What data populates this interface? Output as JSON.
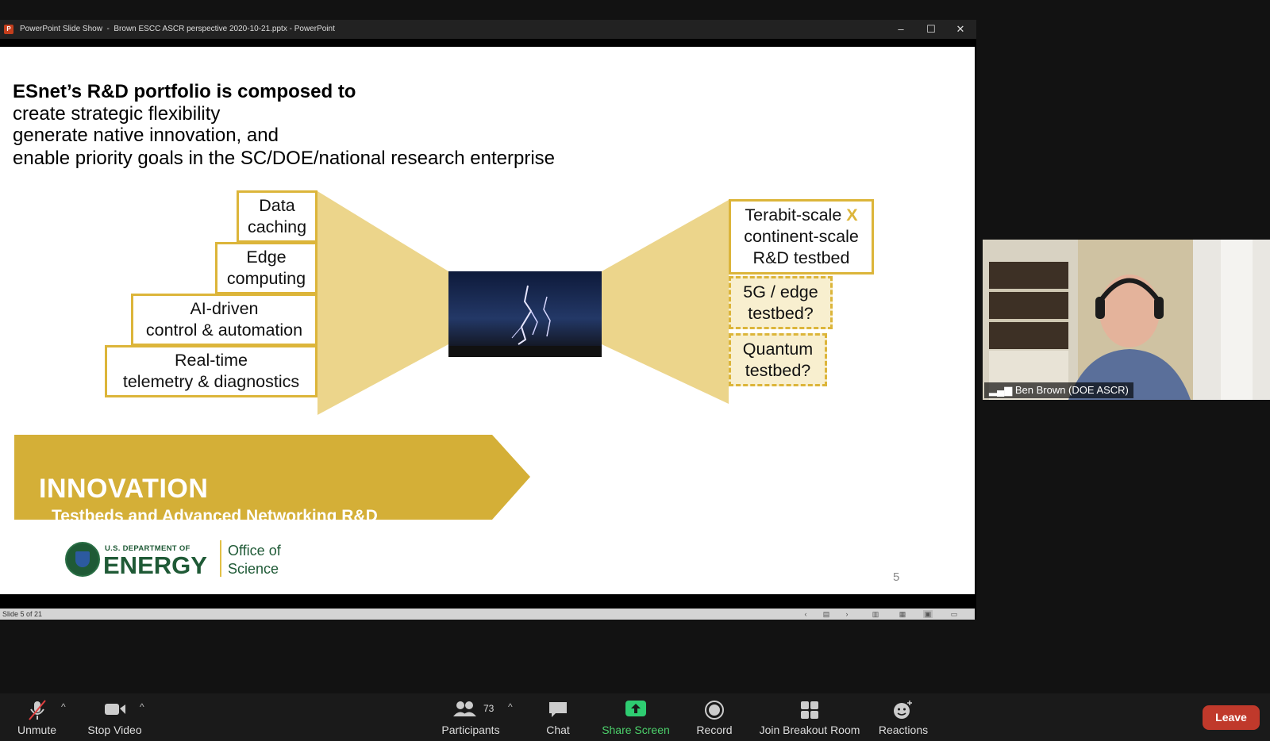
{
  "ppt": {
    "window_title": "PowerPoint Slide Show  -  Brown ESCC ASCR perspective 2020-10-21.pptx - PowerPoint",
    "minimize": "–",
    "maximize": "☐",
    "close": "✕",
    "status_text": "Slide 5 of 21"
  },
  "slide": {
    "title_bold": "ESnet’s R&D portfolio is composed to",
    "lines": [
      "create strategic flexibility",
      "generate native innovation, and",
      "enable priority goals in the SC/DOE/national research enterprise"
    ],
    "left_boxes": [
      {
        "line1": "Data",
        "line2": "caching"
      },
      {
        "line1": "Edge",
        "line2": "computing"
      },
      {
        "line1": "AI-driven",
        "line2": "control & automation"
      },
      {
        "line1": "Real-time",
        "line2": "telemetry & diagnostics"
      }
    ],
    "right_boxes": [
      {
        "line1": "Terabit-scale",
        "mark": "X",
        "line2": "continent-scale",
        "line3": "R&D testbed"
      },
      {
        "line1": "5G / edge",
        "line2": "testbed?"
      },
      {
        "line1": "Quantum",
        "line2": "testbed?"
      }
    ],
    "banner_title": "INNOVATION",
    "banner_subtitle": "Testbeds and Advanced Networking R&D",
    "logo": {
      "dept": "U.S. DEPARTMENT OF",
      "energy": "ENERGY",
      "office1": "Office of",
      "office2": "Science"
    },
    "page_number": "5"
  },
  "video": {
    "participant_name": "Ben Brown (DOE ASCR)"
  },
  "toolbar": {
    "unmute": "Unmute",
    "stop_video": "Stop Video",
    "participants": "Participants",
    "participant_count": "73",
    "chat": "Chat",
    "share_screen": "Share Screen",
    "record": "Record",
    "breakout": "Join Breakout Room",
    "reactions": "Reactions",
    "leave": "Leave"
  },
  "colors": {
    "gold": "#dcb53a",
    "banner": "#d4af37",
    "leave": "#c0392b",
    "share_green": "#2ecc71"
  }
}
